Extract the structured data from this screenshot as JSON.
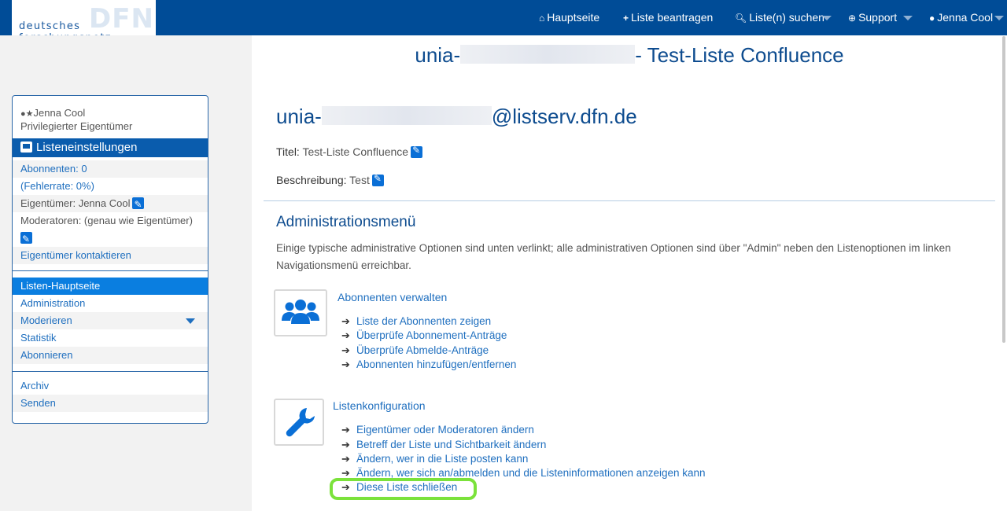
{
  "logo": {
    "mark": "DFN",
    "text": "deutsches forschungsnetz"
  },
  "nav": {
    "home": "Hauptseite",
    "request": "Liste beantragen",
    "search": "Liste(n) suchen",
    "support": "Support",
    "user": "Jenna Cool"
  },
  "sidebar": {
    "owner_name": "Jenna Cool",
    "owner_role": "Privilegierter Eigentümer",
    "settings_label": "Listeneinstellungen",
    "subscribers": "Abonnenten: 0",
    "error_rate": "(Fehlerrate: 0%)",
    "owner_line": "Eigentümer: Jenna Cool",
    "moderators": "Moderatoren: (genau wie Eigentümer)",
    "contact_owner": "Eigentümer kontaktieren",
    "menu": [
      "Listen-Hauptseite",
      "Administration",
      "Moderieren",
      "Statistik",
      "Abonnieren"
    ],
    "menu2": [
      "Archiv",
      "Senden"
    ]
  },
  "main": {
    "title_prefix": "unia-",
    "title_suffix": "- Test-Liste Confluence",
    "addr_prefix": "unia-",
    "addr_suffix": "@listserv.dfn.de",
    "title_label": "Titel:",
    "title_value": "Test-Liste Confluence",
    "desc_label": "Beschreibung:",
    "desc_value": "Test",
    "admin_title": "Administrationsmenü",
    "admin_intro": "Einige typische administrative Optionen sind unten verlinkt; alle administrativen Optionen sind über \"Admin\" neben den Listenoptionen im linken Navigationsmenü erreichbar.",
    "groups": [
      {
        "title": "Abonnenten verwalten",
        "icon": "users-icon",
        "items": [
          "Liste der Abonnenten zeigen",
          "Überprüfe Abonnement-Anträge",
          "Überprüfe Abmelde-Anträge",
          "Abonnenten hinzufügen/entfernen"
        ]
      },
      {
        "title": "Listenkonfiguration",
        "icon": "wrench-icon",
        "items": [
          "Eigentümer oder Moderatoren ändern",
          "Betreff der Liste und Sichtbarkeit ändern",
          "Ändern, wer in die Liste posten kann",
          "Ändern, wer sich an/abmelden und die Listeninformationen anzeigen kann",
          "Diese Liste schließen"
        ]
      }
    ]
  },
  "colors": {
    "header": "#004c97",
    "link": "#1f6fbf",
    "heading": "#0e4c8f",
    "highlight": "#7be23b"
  }
}
